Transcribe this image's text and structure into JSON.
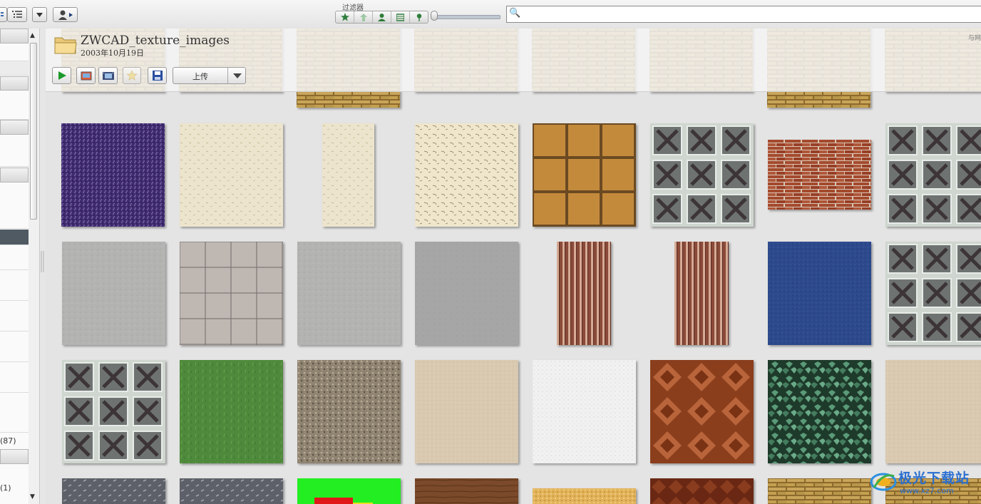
{
  "toolbar": {
    "filter_label": "过滤器",
    "search": {
      "value": "",
      "placeholder": ""
    }
  },
  "folder": {
    "title": "ZWCAD_texture_images",
    "date": "2003年10月19日",
    "upload_label": "上传",
    "corner_text": "与网"
  },
  "sidebar": {
    "count_87": "(87)",
    "count_1": "(1)"
  },
  "watermark": {
    "title": "极光下载站",
    "subtitle": "www.xz7.com"
  },
  "grid": {
    "rows": [
      [
        "brick-tan",
        "brick-tan",
        "brick-tan",
        "brick-tan",
        "brick-tan",
        "brick-tan",
        "brick-tan",
        "brick-tan"
      ],
      [
        "granite-purple",
        "plaster-cream",
        "plaster-cream-narrow",
        "stucco-cream",
        "tile-amber",
        "glass-block",
        "brick-red",
        "glass-block"
      ],
      [
        "concrete-gray",
        "tile-gray-grid",
        "concrete-gray",
        "concrete-flat",
        "corrugated-rust",
        "corrugated-rust",
        "carpet-blue",
        "glass-block"
      ],
      [
        "glass-block",
        "grass-green",
        "gravel",
        "linen-beige",
        "stucco-white",
        "parquet-brown",
        "ivy-leaves",
        "linen-beige"
      ],
      [
        "diamond-plate",
        "diamond-plate",
        "test-green",
        "wood-brown",
        "cork-gold",
        "parquet-dark",
        "brick-tan",
        "brick-tan"
      ]
    ]
  }
}
